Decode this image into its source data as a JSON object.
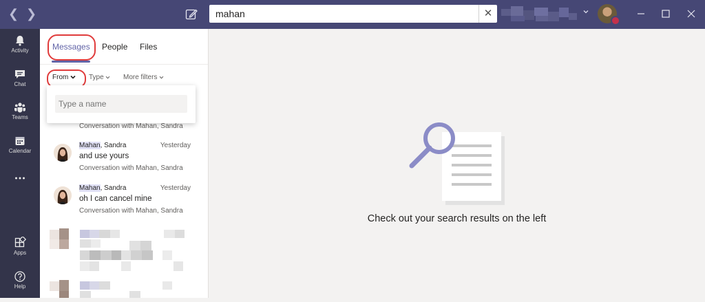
{
  "search": {
    "query": "mahan",
    "clear_icon": "close-icon"
  },
  "rail": [
    {
      "label": "Activity",
      "icon": "bell-icon"
    },
    {
      "label": "Chat",
      "icon": "chat-icon"
    },
    {
      "label": "Teams",
      "icon": "teams-icon"
    },
    {
      "label": "Calendar",
      "icon": "calendar-icon"
    },
    {
      "label": "",
      "icon": "more-icon"
    },
    {
      "label": "Apps",
      "icon": "apps-icon"
    },
    {
      "label": "Help",
      "icon": "help-icon"
    }
  ],
  "tabs": [
    {
      "label": "Messages",
      "active": true
    },
    {
      "label": "People"
    },
    {
      "label": "Files"
    }
  ],
  "filters": {
    "from": "From",
    "type": "Type",
    "more": "More filters"
  },
  "dropdown": {
    "placeholder": "Type a name"
  },
  "results": {
    "partial_conversation": "Conversation with Mahan, Sandra",
    "items": [
      {
        "name_highlight": "Mahan",
        "name_rest": ", Sandra",
        "time": "Yesterday",
        "message": "and use yours",
        "conversation": "Conversation with Mahan, Sandra"
      },
      {
        "name_highlight": "Mahan",
        "name_rest": ", Sandra",
        "time": "Yesterday",
        "message": "oh I can cancel mine",
        "conversation": "Conversation with Mahan, Sandra"
      }
    ]
  },
  "main": {
    "empty_message": "Check out your search results on the left"
  },
  "colors": {
    "brand": "#6264a7",
    "titlebar": "#464775",
    "rail": "#33344a",
    "highlight_oval": "#e03b3b"
  }
}
